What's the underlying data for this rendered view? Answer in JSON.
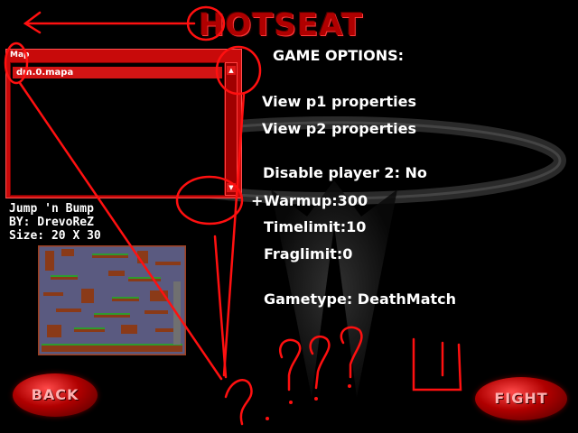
{
  "header": {
    "title": "HOTSEAT"
  },
  "map_panel": {
    "label": "Map",
    "items": [
      "dm.0.mapa"
    ],
    "selected": "dm.0.mapa",
    "scroll_up_icon": "triangle-up",
    "scroll_down_icon": "triangle-down"
  },
  "map_info": {
    "name": "Jump 'n Bump",
    "author": "BY: DrevoReZ",
    "size": "Size: 20 X 30"
  },
  "options": {
    "heading": "GAME OPTIONS:",
    "view_p1": "View p1 properties",
    "view_p2": "View p2 properties",
    "disable_p2": "Disable player 2: No",
    "cursor": "+",
    "warmup": "Warmup:300",
    "timelimit": "Timelimit:10",
    "fraglimit": "Fraglimit:0",
    "gametype": "Gametype: DeathMatch"
  },
  "buttons": {
    "back": "BACK",
    "fight": "FIGHT"
  },
  "colors": {
    "accent": "#d21414",
    "panel": "#c80a0a",
    "annotation": "#ff1010",
    "text": "#ffffff"
  }
}
